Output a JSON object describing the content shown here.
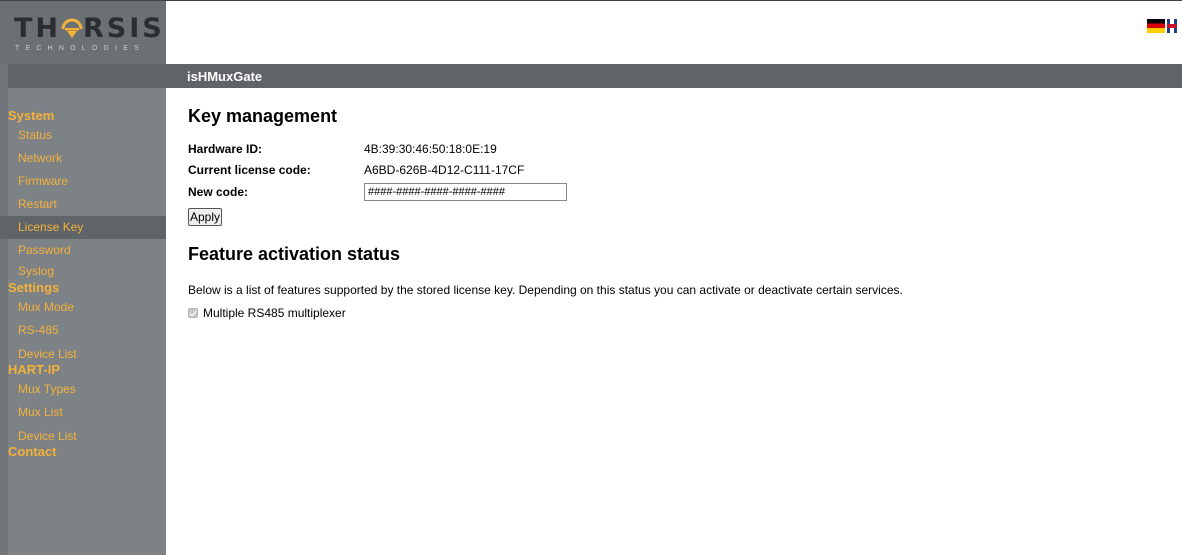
{
  "logo": {
    "name_left": "TH",
    "name_right": "RSIS",
    "tagline": "TECHNOLOGIES"
  },
  "header": {
    "app_title": "isHMuxGate"
  },
  "languages": [
    "de-flag-icon",
    "gb-flag-icon"
  ],
  "colors": {
    "sidebar": "#7d8287",
    "header_bar": "#5f6469",
    "nav_text": "#f4b13a"
  },
  "nav": {
    "system": "System",
    "system_items": [
      "Status",
      "Network",
      "Firmware",
      "Restart",
      "License Key",
      "Password",
      "Syslog"
    ],
    "settings": "Settings",
    "settings_items": [
      "Mux Mode",
      "RS-485",
      "Device List"
    ],
    "hartip": "HART-IP",
    "hartip_items": [
      "Mux Types",
      "Mux List",
      "Device List"
    ],
    "contact": "Contact",
    "active": "License Key"
  },
  "key_management": {
    "title": "Key management",
    "hardware_id_label": "Hardware ID:",
    "hardware_id_value": "4B:39:30:46:50:18:0E:19",
    "current_license_label": "Current license code:",
    "current_license_value": "A6BD-626B-4D12-C111-17CF",
    "new_code_label": "New code:",
    "new_code_value": "####-####-####-####-####",
    "apply_label": "Apply"
  },
  "feature_status": {
    "title": "Feature activation status",
    "description": "Below is a list of features supported by the stored license key. Depending on this status you can activate or deactivate certain services.",
    "features": [
      {
        "label": "Multiple RS485 multiplexer",
        "checked": true
      }
    ]
  }
}
